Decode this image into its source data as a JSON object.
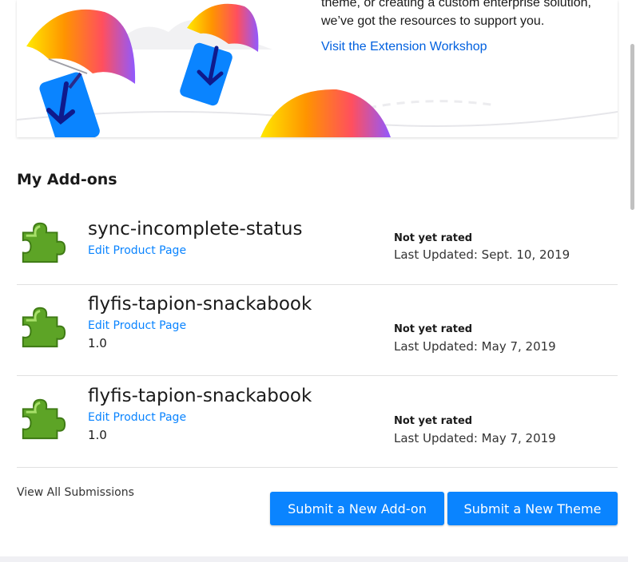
{
  "banner": {
    "text": "theme, or creating a custom enterprise solution, we’ve got the resources to support you.",
    "link_label": "Visit the Extension Workshop"
  },
  "section": {
    "title": "My Add-ons"
  },
  "addons": [
    {
      "name": "sync-incomplete-status",
      "edit_label": "Edit Product Page",
      "version": "",
      "rating": "Not yet rated",
      "updated": "Last Updated: Sept. 10, 2019"
    },
    {
      "name": "flyfis-tapion-snackabook",
      "edit_label": "Edit Product Page",
      "version": "1.0",
      "rating": "Not yet rated",
      "updated": "Last Updated: May 7, 2019"
    },
    {
      "name": "flyfis-tapion-snackabook",
      "edit_label": "Edit Product Page",
      "version": "1.0",
      "rating": "Not yet rated",
      "updated": "Last Updated: May 7, 2019"
    }
  ],
  "footer": {
    "view_all_label": "View All Submissions",
    "submit_addon_label": "Submit a New Add-on",
    "submit_theme_label": "Submit a New Theme"
  },
  "colors": {
    "accent": "#0a84ff",
    "link": "#0060df",
    "icon_green": "#5da426"
  },
  "icons": {
    "addon": "puzzle-piece-icon",
    "banner_art": "parachute-download-icon"
  }
}
